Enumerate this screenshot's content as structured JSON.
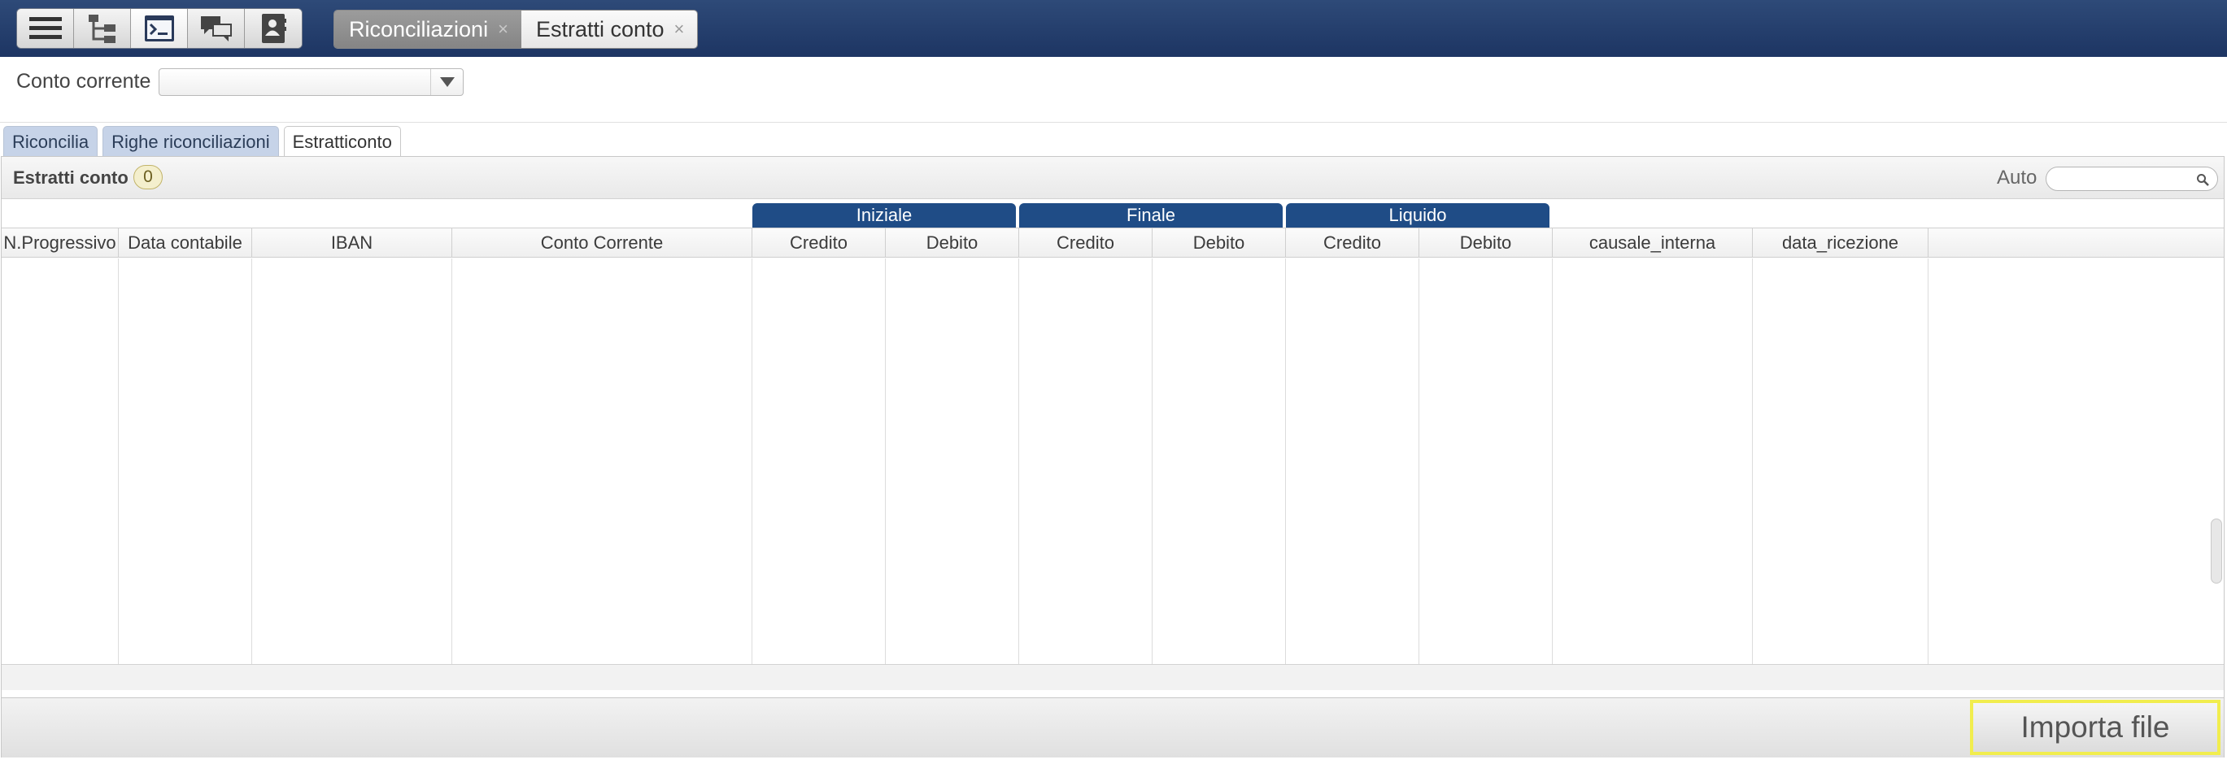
{
  "toolbar": {
    "buttons": [
      {
        "icon": "menu-icon"
      },
      {
        "icon": "tree-icon"
      },
      {
        "icon": "terminal-icon"
      },
      {
        "icon": "chat-icon"
      },
      {
        "icon": "contacts-icon"
      }
    ]
  },
  "doc_tabs": [
    {
      "label": "Riconciliazioni",
      "close": "×"
    },
    {
      "label": "Estratti conto",
      "close": "×"
    }
  ],
  "filter": {
    "label": "Conto corrente",
    "value": ""
  },
  "tabs": [
    {
      "label": "Riconcilia"
    },
    {
      "label": "Righe riconciliazioni"
    },
    {
      "label": "Estratticonto"
    }
  ],
  "panel": {
    "title": "Estratti conto",
    "count": "0",
    "auto_label": "Auto",
    "search_value": ""
  },
  "groups": [
    {
      "label": "Iniziale"
    },
    {
      "label": "Finale"
    },
    {
      "label": "Liquido"
    }
  ],
  "columns": [
    "N.Progressivo",
    "Data contabile",
    "IBAN",
    "Conto Corrente",
    "Credito",
    "Debito",
    "Credito",
    "Debito",
    "Credito",
    "Debito",
    "causale_interna",
    "data_ricezione"
  ],
  "rows": [],
  "footer": {
    "import_label": "Importa file"
  },
  "colors": {
    "topbar": "#1d3563",
    "group_header": "#1f4c86",
    "tab_inactive": "#c6d3e8",
    "highlight": "#f1ed4e"
  }
}
